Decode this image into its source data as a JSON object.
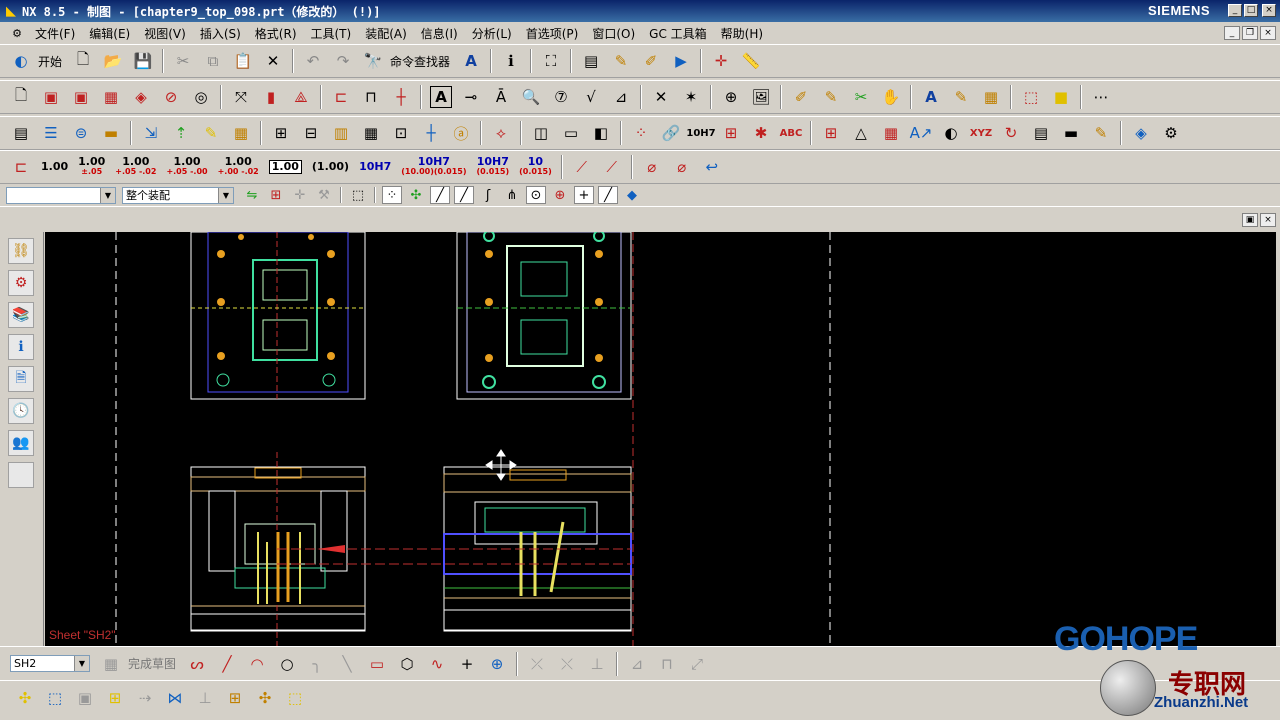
{
  "window": {
    "app_title": "NX 8.5 - 制图 - [chapter9_top_098.prt（修改的）     (!)]",
    "brand": "SIEMENS"
  },
  "menu": [
    "文件(F)",
    "编辑(E)",
    "视图(V)",
    "插入(S)",
    "格式(R)",
    "工具(T)",
    "装配(A)",
    "信息(I)",
    "分析(L)",
    "首选项(P)",
    "窗口(O)",
    "GC 工具箱",
    "帮助(H)"
  ],
  "toolbar1": {
    "start_label": "开始",
    "command_finder_label": "命令查找器"
  },
  "dim_toolbar": {
    "items": [
      {
        "main": "1.00",
        "sub": "",
        "style": "plain"
      },
      {
        "main": "1.00",
        "sub": "±.05",
        "style": "plain"
      },
      {
        "main": "1.00",
        "sub": "+.05 -.02",
        "style": "plain"
      },
      {
        "main": "1.00",
        "sub": "+.05 -.00",
        "style": "plain"
      },
      {
        "main": "1.00",
        "sub": "+.00 -.02",
        "style": "plain"
      },
      {
        "main": "1.00",
        "sub": "",
        "style": "box"
      },
      {
        "main": "(1.00)",
        "sub": "",
        "style": "plain"
      },
      {
        "main": "10H7",
        "sub": "",
        "style": "blue"
      },
      {
        "main": "10H7",
        "sub": "(10.00)(0.015)",
        "style": "blue"
      },
      {
        "main": "10H7",
        "sub": "(0.015)",
        "style": "blue"
      },
      {
        "main": "10",
        "sub": "(0.015)",
        "style": "blue"
      }
    ]
  },
  "selection_bar": {
    "filter_value": "",
    "scope_value": "整个装配"
  },
  "canvas": {
    "sheet_label": "Sheet \"SH2\""
  },
  "bottom_toolbar": {
    "sheet_value": "SH2",
    "finish_sketch_label": "完成草图"
  },
  "watermark": {
    "gohope": "GOHOPE",
    "site_cn": "专职网",
    "site_url": "Zhuanzhi.Net"
  },
  "colors": {
    "canvas_bg": "#000000",
    "drawing_frame": "#ffffff",
    "center_line": "#c03030",
    "fastener": "#e8a020",
    "part_line": "#40e0a0"
  }
}
